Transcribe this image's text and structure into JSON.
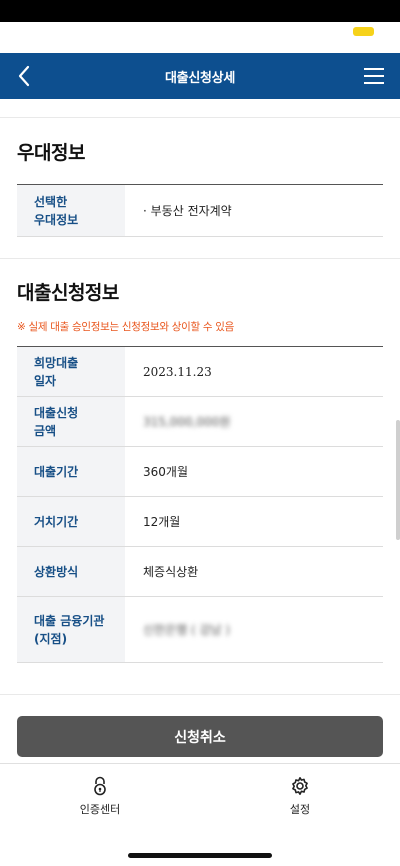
{
  "header": {
    "title": "대출신청상세"
  },
  "icons": {
    "back": "chevron-left-icon",
    "menu": "hamburger-menu-icon",
    "certificate": "lock-icon",
    "settings": "gear-icon"
  },
  "colors": {
    "header_bg": "#0d4f8f",
    "label_text": "#174f86",
    "notice_text": "#e9561d",
    "button_bg": "#555555"
  },
  "benefit": {
    "title": "우대정보",
    "rows": [
      {
        "label": "선택한\n우대정보",
        "value": "· 부동산 전자계약"
      }
    ]
  },
  "loan": {
    "title": "대출신청정보",
    "notice": "※ 실제 대출 승인정보는 신청정보와 상이할 수 있음",
    "rows": [
      {
        "label": "희망대출\n일자",
        "value": "2023.11.23"
      },
      {
        "label": "대출신청\n금액",
        "value": "315,000,000원"
      },
      {
        "label": "대출기간",
        "value": "360개월"
      },
      {
        "label": "거치기간",
        "value": "12개월"
      },
      {
        "label": "상환방식",
        "value": "체증식상환"
      },
      {
        "label": "대출 금융기관\n(지점)",
        "value": "신한은행 ( 강남 )"
      }
    ]
  },
  "actions": {
    "cancel_label": "신청취소"
  },
  "tabbar": {
    "items": [
      {
        "label": "인증센터"
      },
      {
        "label": "설정"
      }
    ]
  }
}
